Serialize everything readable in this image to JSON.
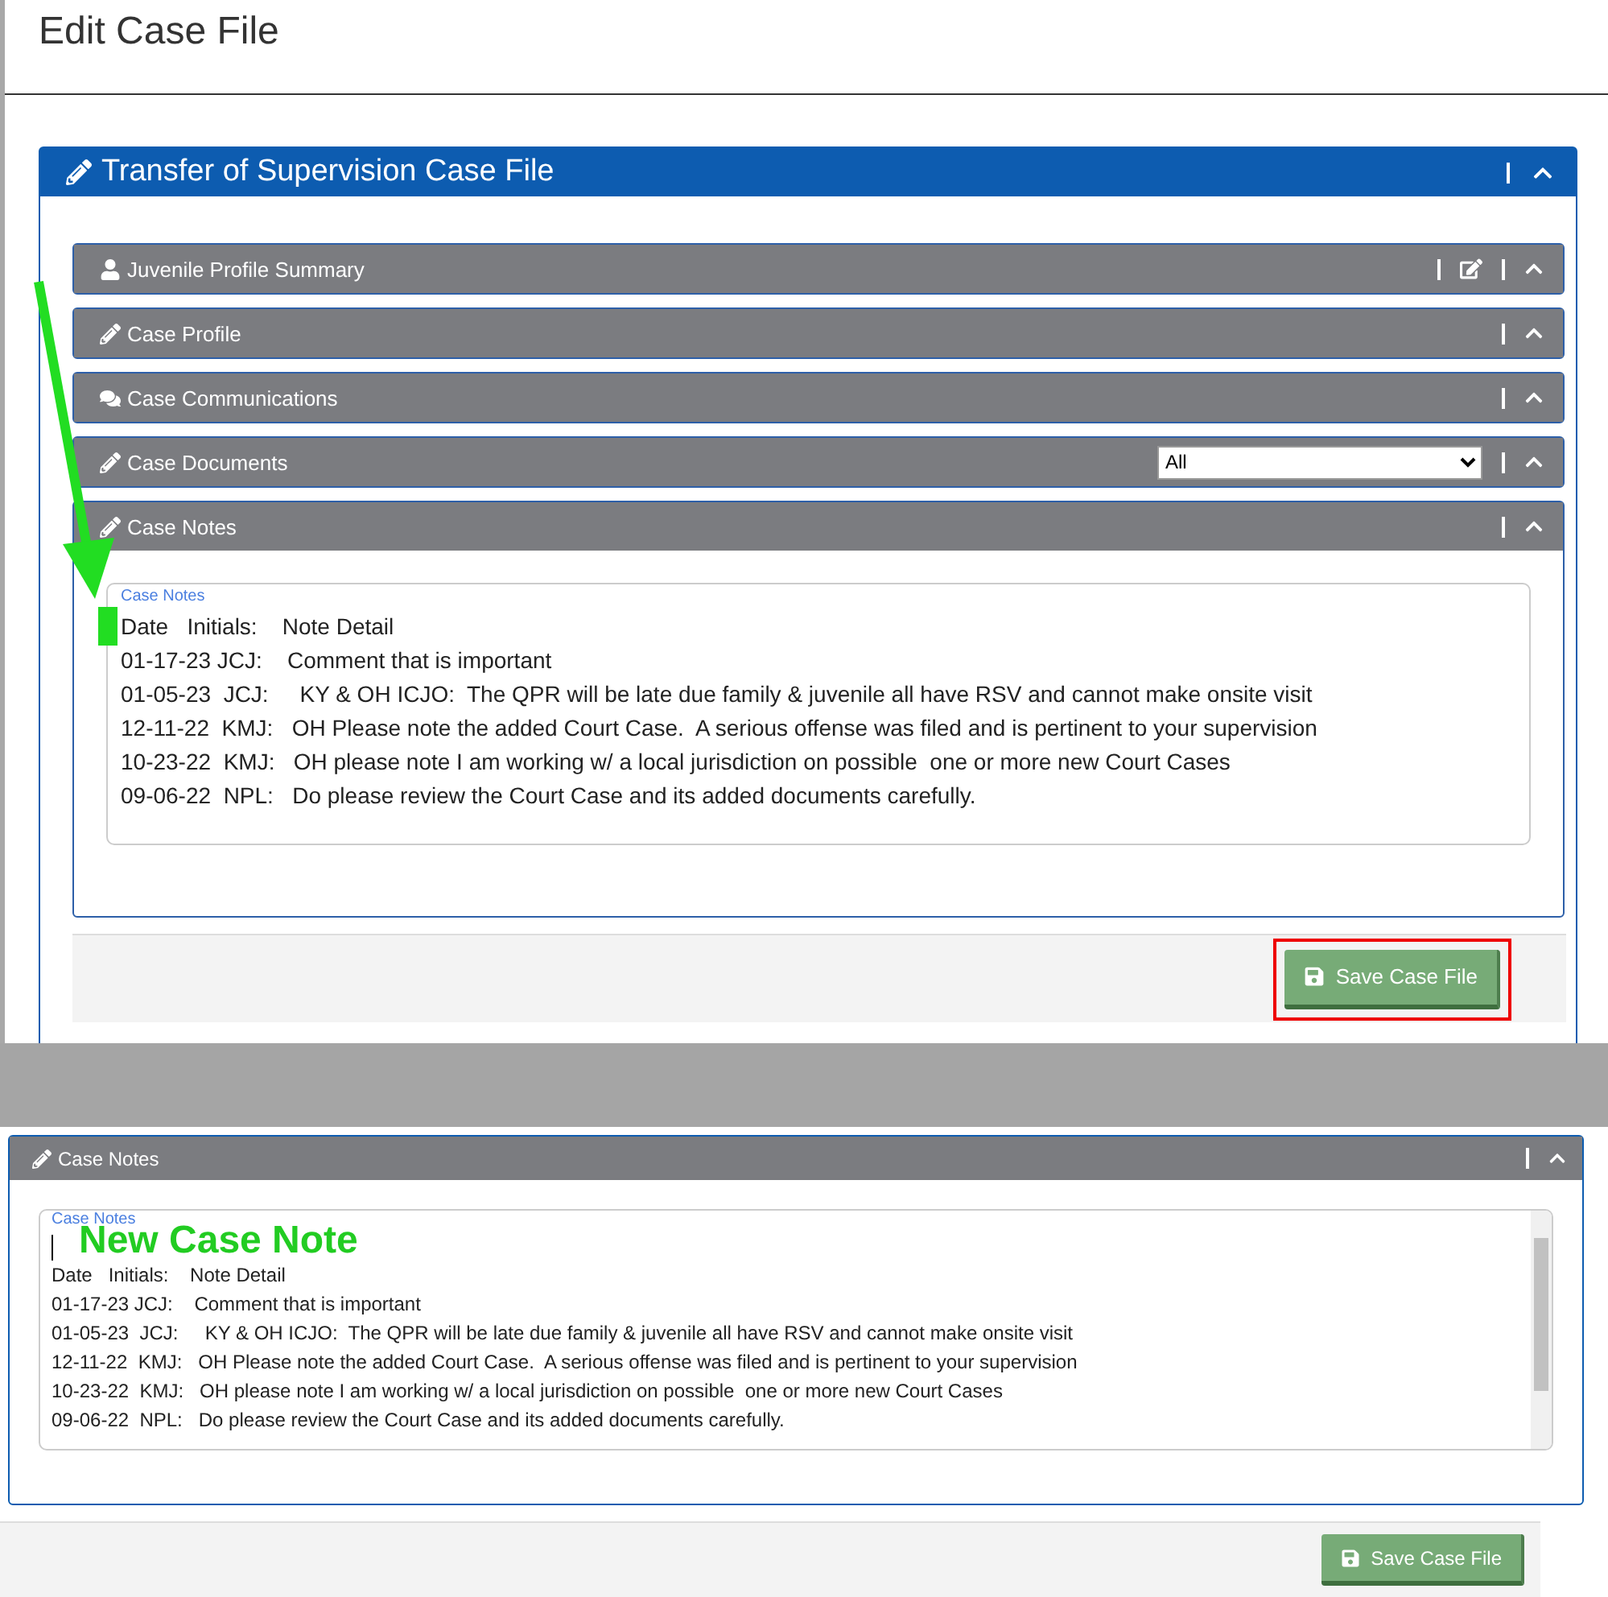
{
  "page_title": "Edit Case File",
  "main_panel": {
    "title": "Transfer of Supervision Case File",
    "sections": [
      {
        "title": "Juvenile Profile Summary",
        "kind": "summary"
      },
      {
        "title": "Case Profile",
        "kind": "plain"
      },
      {
        "title": "Case Communications",
        "kind": "chat"
      },
      {
        "title": "Case Documents",
        "kind": "select",
        "select_value": "All"
      },
      {
        "title": "Case Notes",
        "kind": "notes"
      }
    ],
    "notes_label": "Case Notes",
    "notes": [
      "Date   Initials:    Note Detail",
      "01-17-23 JCJ:    Comment that is important",
      "01-05-23  JCJ:     KY & OH ICJO:  The QPR will be late due family & juvenile all have RSV and cannot make onsite visit",
      "12-11-22  KMJ:   OH Please note the added Court Case.  A serious offense was filed and is pertinent to your supervision",
      "10-23-22  KMJ:   OH please note I am working w/ a local jurisdiction on possible  one or more new Court Cases",
      "09-06-22  NPL:   Do please review the Court Case and its added documents carefully."
    ],
    "save_button": "Save Case File"
  },
  "detail_view": {
    "section_title": "Case Notes",
    "notes_label": "Case Notes",
    "new_note_annotation": "New Case Note",
    "notes": [
      "Date   Initials:    Note Detail",
      "01-17-23 JCJ:    Comment that is important",
      "01-05-23  JCJ:     KY & OH ICJO:  The QPR will be late due family & juvenile all have RSV and cannot make onsite visit",
      "12-11-22  KMJ:   OH Please note the added Court Case.  A serious offense was filed and is pertinent to your supervision",
      "10-23-22  KMJ:   OH please note I am working w/ a local jurisdiction on possible  one or more new Court Cases",
      "09-06-22  NPL:   Do please review the Court Case and its added documents carefully."
    ],
    "save_button": "Save Case File"
  }
}
